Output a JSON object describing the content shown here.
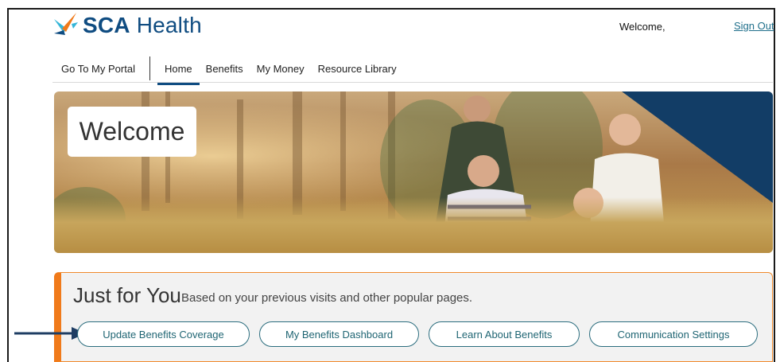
{
  "brand": {
    "name_bold": "SCA",
    "name_light": "Health"
  },
  "header": {
    "welcome": "Welcome,",
    "sign_out": "Sign Out"
  },
  "nav": {
    "portal": "Go To My Portal",
    "items": [
      "Home",
      "Benefits",
      "My Money",
      "Resource Library"
    ],
    "active": "Home"
  },
  "hero": {
    "heading": "Welcome"
  },
  "just_for_you": {
    "title": "Just for You",
    "subtitle": "Based on your previous visits and other popular pages.",
    "buttons": [
      "Update Benefits Coverage",
      "My Benefits Dashboard",
      "Learn About Benefits",
      "Communication Settings"
    ]
  },
  "colors": {
    "brand_blue": "#0f4c81",
    "accent_orange": "#f07a1a",
    "teal": "#1f6573",
    "navy_triangle": "#123d66"
  },
  "icons": {
    "logo": "sca-logo-mark",
    "annotation": "arrow-right-icon"
  }
}
